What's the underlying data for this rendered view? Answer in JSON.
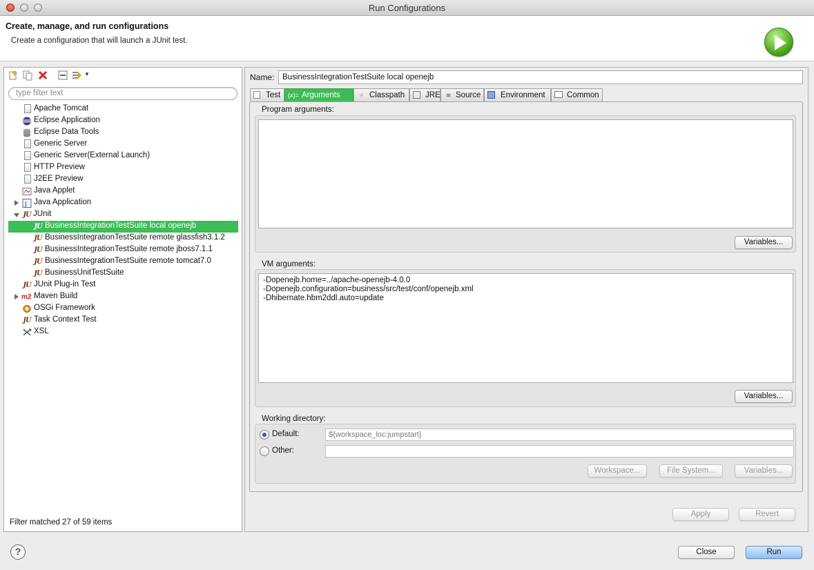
{
  "window": {
    "title": "Run Configurations"
  },
  "banner": {
    "heading": "Create, manage, and run configurations",
    "subtitle": "Create a configuration that will launch a JUnit test."
  },
  "left": {
    "filter_placeholder": "type filter text",
    "status": "Filter matched 27 of 59 items",
    "tree": [
      {
        "label": "Apache Tomcat",
        "icon": "server-icon",
        "level": 0
      },
      {
        "label": "Eclipse Application",
        "icon": "eclipse-icon",
        "level": 0
      },
      {
        "label": "Eclipse Data Tools",
        "icon": "database-icon",
        "level": 0
      },
      {
        "label": "Generic Server",
        "icon": "server-icon",
        "level": 0
      },
      {
        "label": "Generic Server(External Launch)",
        "icon": "server-icon",
        "level": 0
      },
      {
        "label": "HTTP Preview",
        "icon": "server-icon",
        "level": 0
      },
      {
        "label": "J2EE Preview",
        "icon": "server-icon",
        "level": 0
      },
      {
        "label": "Java Applet",
        "icon": "applet-icon",
        "level": 0
      },
      {
        "label": "Java Application",
        "icon": "java-app-icon",
        "level": 0,
        "expander": "collapsed"
      },
      {
        "label": "JUnit",
        "icon": "junit-icon",
        "level": 0,
        "expander": "expanded"
      },
      {
        "label": "BusinessIntegrationTestSuite local openejb",
        "icon": "junit-icon",
        "level": 1,
        "selected": true
      },
      {
        "label": "BusinessIntegrationTestSuite remote glassfish3.1.2",
        "icon": "junit-icon",
        "level": 1
      },
      {
        "label": "BusinessIntegrationTestSuite remote jboss7.1.1",
        "icon": "junit-icon",
        "level": 1
      },
      {
        "label": "BusinessIntegrationTestSuite remote tomcat7.0",
        "icon": "junit-icon",
        "level": 1
      },
      {
        "label": "BusinessUnitTestSuite",
        "icon": "junit-icon",
        "level": 1
      },
      {
        "label": "JUnit Plug-in Test",
        "icon": "junit-plugin-icon",
        "level": 0
      },
      {
        "label": "Maven Build",
        "icon": "maven-icon",
        "level": 0,
        "expander": "collapsed"
      },
      {
        "label": "OSGi Framework",
        "icon": "osgi-icon",
        "level": 0
      },
      {
        "label": "Task Context Test",
        "icon": "junit-plugin-icon",
        "level": 0
      },
      {
        "label": "XSL",
        "icon": "xsl-icon",
        "level": 0
      }
    ]
  },
  "right": {
    "name_label": "Name:",
    "name_value": "BusinessIntegrationTestSuite local openejb",
    "tabs": [
      {
        "label": "Test",
        "icon": "test-tab-icon"
      },
      {
        "label": "Arguments",
        "icon": "arguments-tab-icon",
        "active": true
      },
      {
        "label": "Classpath",
        "icon": "classpath-tab-icon"
      },
      {
        "label": "JRE",
        "icon": "jre-tab-icon"
      },
      {
        "label": "Source",
        "icon": "source-tab-icon"
      },
      {
        "label": "Environment",
        "icon": "environment-tab-icon"
      },
      {
        "label": "Common",
        "icon": "common-tab-icon"
      }
    ],
    "program_args_label": "Program arguments:",
    "program_args_value": "",
    "vm_args_label": "VM arguments:",
    "vm_args_value": "-Dopenejb.home=../apache-openejb-4.0.0\n-Dopenejb.configuration=business/src/test/conf/openejb.xml\n-Dhibernate.hbm2ddl.auto=update",
    "variables_label": "Variables...",
    "working_dir_label": "Working directory:",
    "default_label": "Default:",
    "default_value": "${workspace_loc:jumpstart}",
    "other_label": "Other:",
    "other_value": "",
    "workspace_label": "Workspace...",
    "filesystem_label": "File System...",
    "apply_label": "Apply",
    "revert_label": "Revert"
  },
  "footer": {
    "close_label": "Close",
    "run_label": "Run",
    "help_label": "?"
  },
  "colors": {
    "selection": "#3cbd55",
    "primary_button": "#8fbff0"
  }
}
